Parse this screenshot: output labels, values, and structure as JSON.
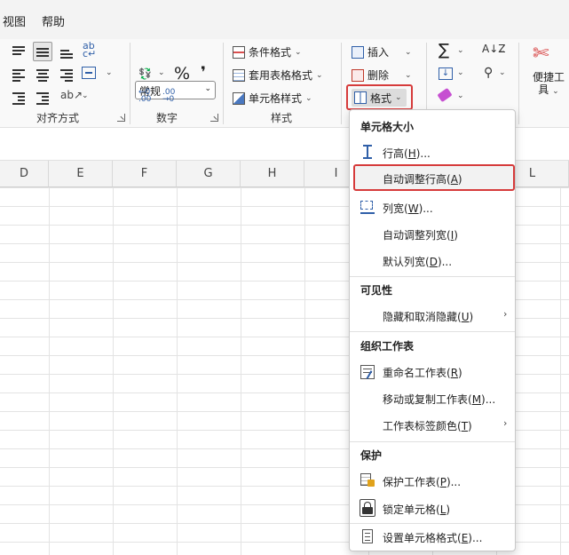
{
  "tabs": {
    "view": "视图",
    "help": "帮助"
  },
  "ribbon": {
    "alignment_group": {
      "label": "对齐方式"
    },
    "number_group": {
      "label": "数字",
      "format_value": "常规",
      "percent_symbol": "%",
      "comma_symbol": "❜"
    },
    "styles_group": {
      "label": "样式",
      "conditional": "条件格式",
      "table": "套用表格格式",
      "cell_styles": "单元格样式"
    },
    "cells_group": {
      "insert": "插入",
      "delete": "删除",
      "format": "格式"
    },
    "editing_group": {
      "sum_symbol": "∑"
    },
    "quick_tools": "便捷工具"
  },
  "columns": [
    "D",
    "E",
    "F",
    "G",
    "H",
    "I",
    "L"
  ],
  "menu": {
    "section_cell_size": "单元格大小",
    "row_height": "行高(",
    "row_height_key": "H",
    "row_height_tail": ")...",
    "autofit_row": "自动调整行高(",
    "autofit_row_key": "A",
    "autofit_row_tail": ")",
    "col_width": "列宽(",
    "col_width_key": "W",
    "col_width_tail": ")...",
    "autofit_col": "自动调整列宽(",
    "autofit_col_key": "I",
    "autofit_col_tail": ")",
    "default_width": "默认列宽(",
    "default_width_key": "D",
    "default_width_tail": ")...",
    "section_visibility": "可见性",
    "hide_unhide": "隐藏和取消隐藏(",
    "hide_unhide_key": "U",
    "hide_unhide_tail": ")",
    "section_organize": "组织工作表",
    "rename": "重命名工作表(",
    "rename_key": "R",
    "rename_tail": ")",
    "move_copy": "移动或复制工作表(",
    "move_copy_key": "M",
    "move_copy_tail": ")...",
    "tab_color": "工作表标签颜色(",
    "tab_color_key": "T",
    "tab_color_tail": ")",
    "section_protect": "保护",
    "protect_sheet": "保护工作表(",
    "protect_sheet_key": "P",
    "protect_sheet_tail": ")...",
    "lock_cell": "锁定单元格(",
    "lock_cell_key": "L",
    "lock_cell_tail": ")",
    "format_cells": "设置单元格格式(",
    "format_cells_key": "E",
    "format_cells_tail": ")..."
  },
  "colors": {
    "highlight_border": "#d63b3b",
    "accent_blue": "#2f5fa8",
    "accent_green": "#1e7a46"
  }
}
